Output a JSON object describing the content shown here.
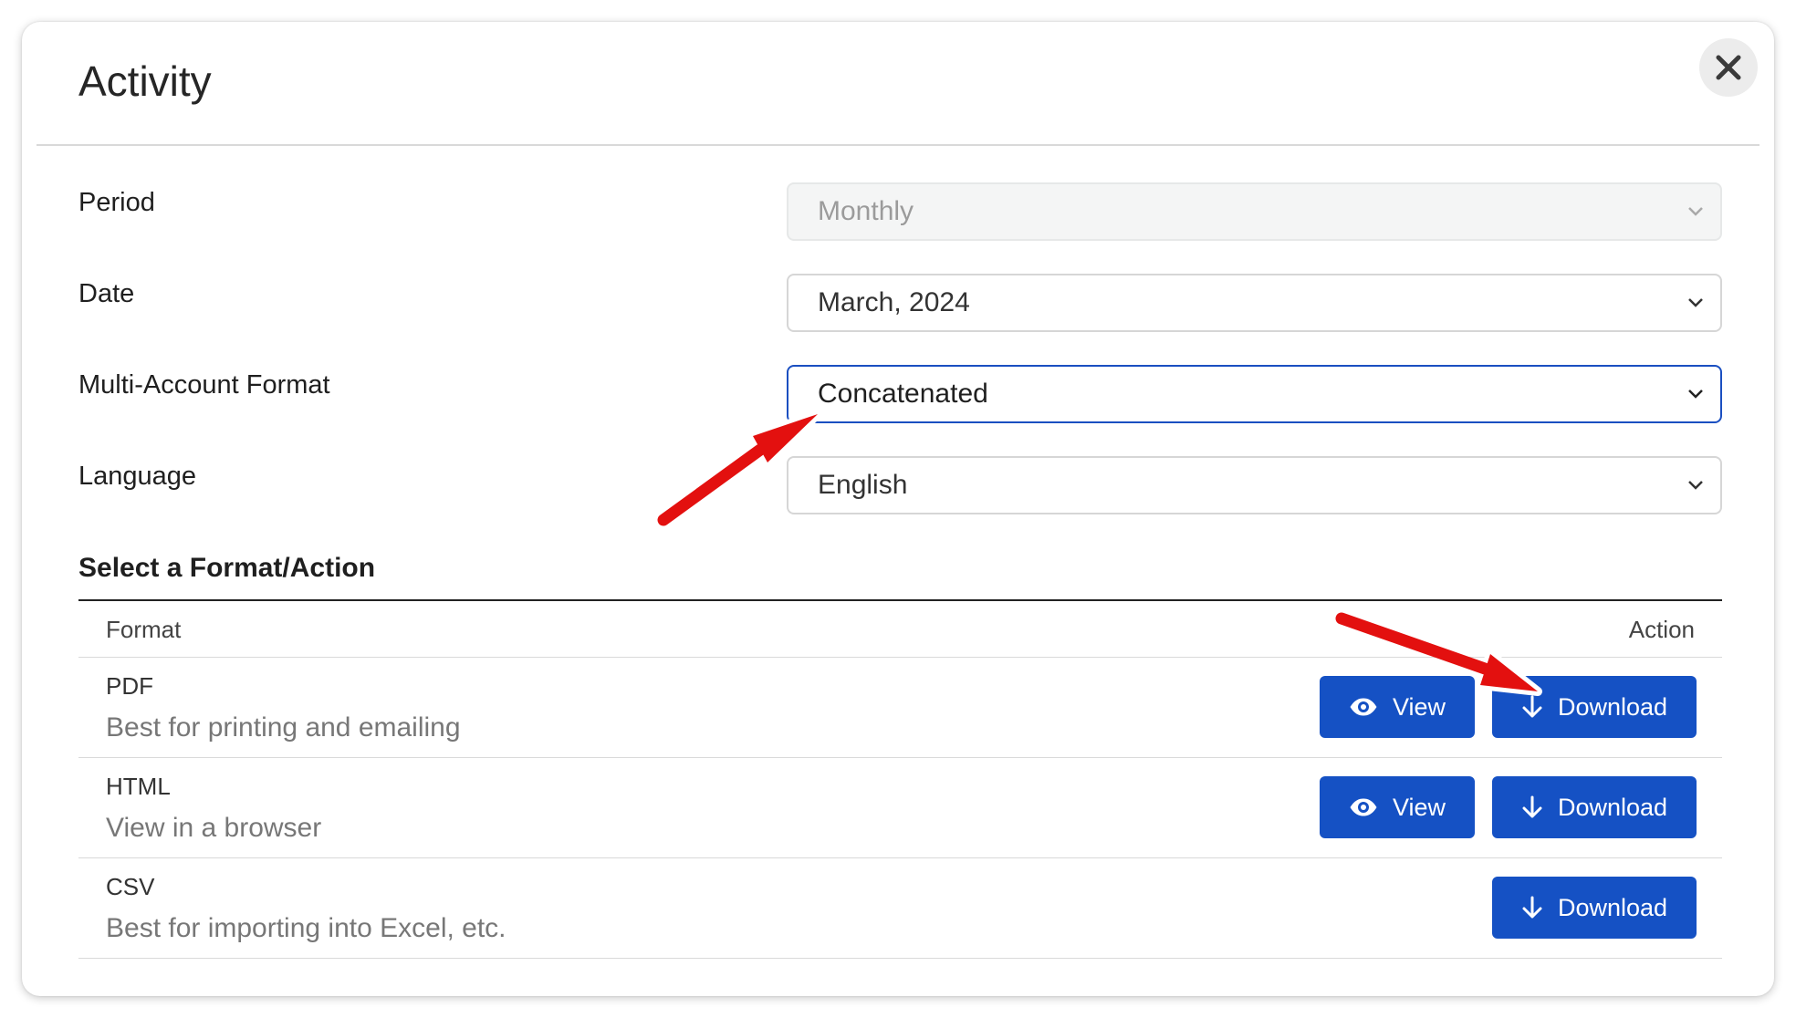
{
  "dialog": {
    "title": "Activity",
    "close_icon": "close-icon"
  },
  "fields": {
    "period": {
      "label": "Period",
      "value": "Monthly",
      "disabled": true
    },
    "date": {
      "label": "Date",
      "value": "March, 2024"
    },
    "multi_account_format": {
      "label": "Multi-Account Format",
      "value": "Concatenated",
      "focused": true
    },
    "language": {
      "label": "Language",
      "value": "English"
    }
  },
  "formats": {
    "section_title": "Select a Format/Action",
    "columns": {
      "format": "Format",
      "action": "Action"
    },
    "rows": [
      {
        "name": "PDF",
        "description": "Best for printing and emailing",
        "view_label": "View",
        "download_label": "Download"
      },
      {
        "name": "HTML",
        "description": "View in a browser",
        "view_label": "View",
        "download_label": "Download"
      },
      {
        "name": "CSV",
        "description": "Best for importing into Excel, etc.",
        "download_label": "Download"
      }
    ]
  },
  "colors": {
    "button_primary": "#1551c4",
    "focus_border": "#1a4fc1",
    "annotation_arrow": "#e3100f"
  },
  "icons": {
    "view": "eye-icon",
    "download": "arrow-down-icon",
    "dropdown": "chevron-down-icon"
  }
}
